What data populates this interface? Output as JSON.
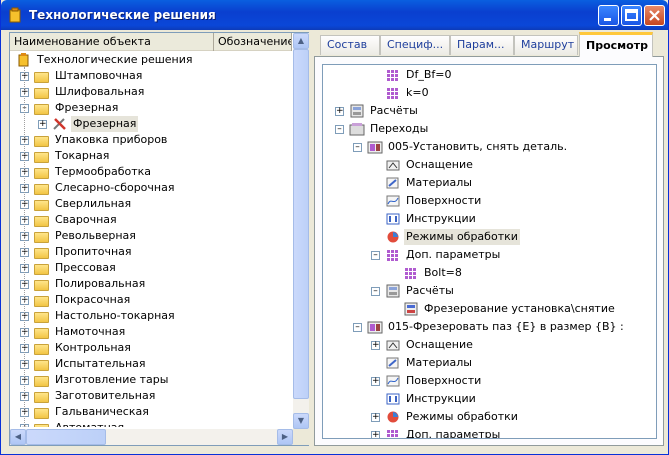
{
  "window": {
    "title": "Технологические решения"
  },
  "left_panel": {
    "columns": [
      "Наименование объекта",
      "Обозначение о"
    ],
    "tree": [
      {
        "label": "Технологические решения",
        "level": 0,
        "icon": "root-folder-icon"
      },
      {
        "label": "Штамповочная",
        "level": 1,
        "icon": "folder-icon",
        "exp": "+"
      },
      {
        "label": "Шлифовальная",
        "level": 1,
        "icon": "folder-icon",
        "exp": "+"
      },
      {
        "label": "Фрезерная",
        "level": 1,
        "icon": "folder-icon",
        "exp": "−"
      },
      {
        "label": "Фрезерная",
        "level": 2,
        "icon": "tools-icon",
        "exp": "+",
        "selected": true
      },
      {
        "label": "Упаковка приборов",
        "level": 1,
        "icon": "folder-icon",
        "exp": "+"
      },
      {
        "label": "Токарная",
        "level": 1,
        "icon": "folder-icon",
        "exp": "+"
      },
      {
        "label": "Термообработка",
        "level": 1,
        "icon": "folder-icon",
        "exp": "+"
      },
      {
        "label": "Слесарно-сборочная",
        "level": 1,
        "icon": "folder-icon",
        "exp": "+"
      },
      {
        "label": "Сверлильная",
        "level": 1,
        "icon": "folder-icon",
        "exp": "+"
      },
      {
        "label": "Сварочная",
        "level": 1,
        "icon": "folder-icon",
        "exp": "+"
      },
      {
        "label": "Револьверная",
        "level": 1,
        "icon": "folder-icon",
        "exp": "+"
      },
      {
        "label": "Пропиточная",
        "level": 1,
        "icon": "folder-icon",
        "exp": "+"
      },
      {
        "label": "Прессовая",
        "level": 1,
        "icon": "folder-icon",
        "exp": "+"
      },
      {
        "label": "Полировальная",
        "level": 1,
        "icon": "folder-icon",
        "exp": "+"
      },
      {
        "label": "Покрасочная",
        "level": 1,
        "icon": "folder-icon",
        "exp": "+"
      },
      {
        "label": "Настольно-токарная",
        "level": 1,
        "icon": "folder-icon",
        "exp": "+"
      },
      {
        "label": "Намоточная",
        "level": 1,
        "icon": "folder-icon",
        "exp": "+"
      },
      {
        "label": "Контрольная",
        "level": 1,
        "icon": "folder-icon",
        "exp": "+"
      },
      {
        "label": "Испытательная",
        "level": 1,
        "icon": "folder-icon",
        "exp": "+"
      },
      {
        "label": "Изготовление тары",
        "level": 1,
        "icon": "folder-icon",
        "exp": "+"
      },
      {
        "label": "Заготовительная",
        "level": 1,
        "icon": "folder-icon",
        "exp": "+"
      },
      {
        "label": "Гальваническая",
        "level": 1,
        "icon": "folder-icon",
        "exp": "+"
      },
      {
        "label": "Автоматная",
        "level": 1,
        "icon": "folder-icon",
        "exp": "+"
      }
    ]
  },
  "tabs": [
    {
      "label": "Состав",
      "active": false
    },
    {
      "label": "Специф...",
      "active": false
    },
    {
      "label": "Парам...",
      "active": false
    },
    {
      "label": "Маршрут",
      "active": false
    },
    {
      "label": "Просмотр",
      "active": true
    }
  ],
  "view_tree": [
    {
      "label": "Df_Bf=0",
      "level": 3,
      "icon": "param-icon"
    },
    {
      "label": "k=0",
      "level": 3,
      "icon": "param-icon"
    },
    {
      "label": "Расчёты",
      "level": 1,
      "icon": "calc-icon",
      "exp": "+"
    },
    {
      "label": "Переходы",
      "level": 1,
      "icon": "steps-icon",
      "exp": "−"
    },
    {
      "label": "005-Установить, снять деталь.",
      "level": 2,
      "icon": "step-icon",
      "exp": "−"
    },
    {
      "label": "Оснащение",
      "level": 3,
      "icon": "equipment-icon"
    },
    {
      "label": "Материалы",
      "level": 3,
      "icon": "materials-icon"
    },
    {
      "label": "Поверхности",
      "level": 3,
      "icon": "surfaces-icon"
    },
    {
      "label": "Инструкции",
      "level": 3,
      "icon": "instructions-icon"
    },
    {
      "label": "Режимы обработки",
      "level": 3,
      "icon": "modes-icon",
      "selected": true
    },
    {
      "label": "Доп. параметры",
      "level": 3,
      "icon": "param-icon",
      "exp": "−"
    },
    {
      "label": "Bolt=8",
      "level": 4,
      "icon": "param-icon"
    },
    {
      "label": "Расчёты",
      "level": 3,
      "icon": "calc-icon",
      "exp": "−"
    },
    {
      "label": "Фрезерование установка\\снятие",
      "level": 4,
      "icon": "calc-item-icon"
    },
    {
      "label": "015-Фрезеровать паз {E} в размер {B} :",
      "level": 2,
      "icon": "step-icon",
      "exp": "−"
    },
    {
      "label": "Оснащение",
      "level": 3,
      "icon": "equipment-icon",
      "exp": "+"
    },
    {
      "label": "Материалы",
      "level": 3,
      "icon": "materials-icon"
    },
    {
      "label": "Поверхности",
      "level": 3,
      "icon": "surfaces-icon",
      "exp": "+"
    },
    {
      "label": "Инструкции",
      "level": 3,
      "icon": "instructions-icon"
    },
    {
      "label": "Режимы обработки",
      "level": 3,
      "icon": "modes-icon",
      "exp": "+"
    },
    {
      "label": "Доп. параметры",
      "level": 3,
      "icon": "param-icon",
      "exp": "+"
    }
  ]
}
